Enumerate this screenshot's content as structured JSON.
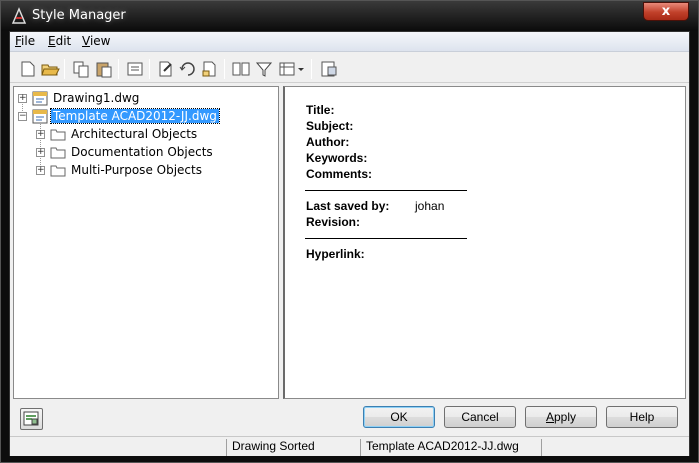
{
  "window": {
    "title": "Style Manager",
    "close_label": "x"
  },
  "menu": {
    "items": [
      {
        "label_u": "F",
        "label_rest": "ile"
      },
      {
        "label_u": "E",
        "label_rest": "dit"
      },
      {
        "label_u": "V",
        "label_rest": "iew"
      }
    ]
  },
  "toolbar": {
    "buttons": [
      "new-icon",
      "open-icon",
      "copy-icon",
      "paste-icon",
      "purge-icon",
      "edit-style-icon",
      "reload-icon",
      "set-from-icon",
      "compare-icon",
      "filter-icon",
      "view-list-icon",
      "toggle-view-icon"
    ]
  },
  "tree": {
    "items": [
      {
        "label": "Drawing1.dwg",
        "expander": "+"
      },
      {
        "label": "Template ACAD2012-JJ.dwg",
        "expander": "−",
        "selected": true
      },
      {
        "label": "Architectural Objects",
        "expander": "+"
      },
      {
        "label": "Documentation Objects",
        "expander": "+"
      },
      {
        "label": "Multi-Purpose Objects",
        "expander": "+"
      }
    ]
  },
  "details": {
    "title_label": "Title:",
    "subject_label": "Subject:",
    "author_label": "Author:",
    "keywords_label": "Keywords:",
    "comments_label": "Comments:",
    "last_saved_label": "Last saved by:",
    "last_saved_value": "johan",
    "revision_label": "Revision:",
    "hyperlink_label": "Hyperlink:"
  },
  "buttons": {
    "ok": "OK",
    "cancel": "Cancel",
    "apply_u": "A",
    "apply_rest": "pply",
    "help": "Help"
  },
  "status": {
    "cell1": "",
    "cell2": "Drawing Sorted",
    "cell3": "Template ACAD2012-JJ.dwg"
  },
  "colors": {
    "selection": "#3399ff",
    "close_button": "#c1402a"
  }
}
